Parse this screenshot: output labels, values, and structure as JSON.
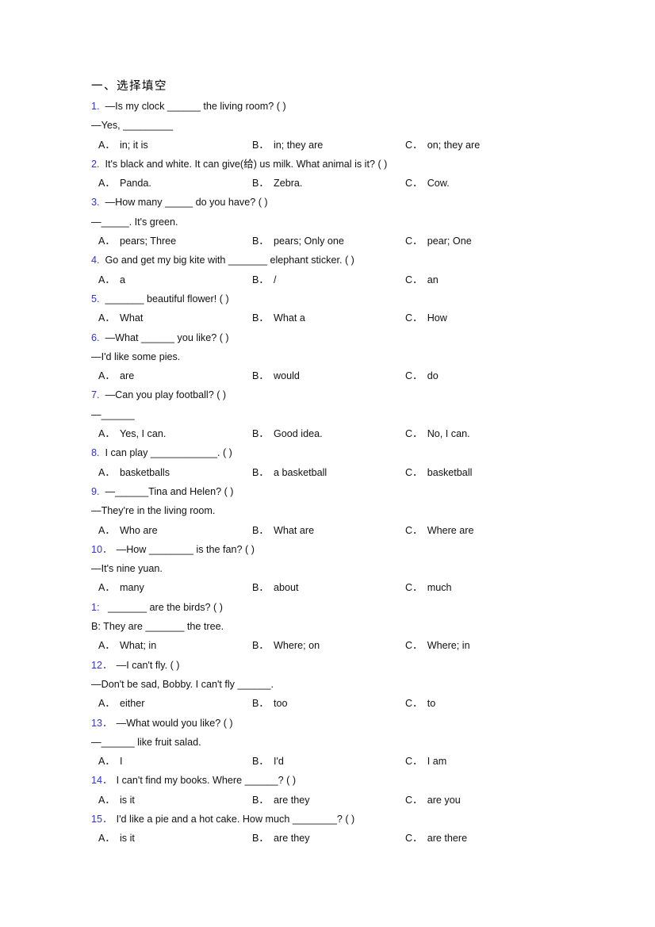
{
  "document": {
    "section_title": "一、选择填空",
    "option_labels": [
      "A．",
      "B．",
      "C．"
    ],
    "questions": [
      {
        "number": "1.",
        "stem": "—Is my clock ______ the living room? (  )",
        "continuation": "—Yes, _________",
        "options": [
          "in; it is",
          "in; they are",
          "on; they are"
        ]
      },
      {
        "number": "2.",
        "stem": "It's black and white. It can give(给) us milk. What animal is it? (  )",
        "continuation": "",
        "options": [
          "Panda.",
          "Zebra.",
          "Cow."
        ]
      },
      {
        "number": "3.",
        "stem": "—How many _____ do you have? (  )",
        "continuation": "—_____. It's green.",
        "options": [
          "pears; Three",
          "pears; Only one",
          "pear; One"
        ]
      },
      {
        "number": "4.",
        "stem": "Go and get my big kite with _______ elephant sticker. (   )",
        "continuation": "",
        "options": [
          "a",
          "/",
          "an"
        ]
      },
      {
        "number": "5.",
        "stem": "_______ beautiful flower! (   )",
        "continuation": "",
        "options": [
          "What",
          "What a",
          "How"
        ]
      },
      {
        "number": "6.",
        "stem": "—What ______ you like? (  )",
        "continuation": "—I'd like some pies.",
        "options": [
          "are",
          "would",
          "do"
        ]
      },
      {
        "number": "7.",
        "stem": "—Can you play football? (  )",
        "continuation": "—______",
        "options": [
          "Yes, I can.",
          "Good idea.",
          "No, I can."
        ]
      },
      {
        "number": "8.",
        "stem": "I can play ____________. (  )",
        "continuation": "",
        "options": [
          "basketballs",
          "a basketball",
          "basketball"
        ]
      },
      {
        "number": "9.",
        "stem": "—______Tina and Helen? (   )",
        "continuation": "—They're in the living room.",
        "options": [
          "Who are",
          "What are",
          "Where are"
        ]
      },
      {
        "number": "10．",
        "stem": "—How ________ is the fan? (    )",
        "continuation": "—It's nine yuan.",
        "options": [
          "many",
          "about",
          "much"
        ]
      },
      {
        "number": "1:",
        "stem": " _______ are the birds? (  )",
        "continuation": "B: They are _______ the tree.",
        "options": [
          "What; in",
          "Where; on",
          "Where; in"
        ]
      },
      {
        "number": "12．",
        "stem": "—I can't fly. (  )",
        "continuation": "—Don't be sad, Bobby. I can't fly ______.",
        "options": [
          "either",
          "too",
          "to"
        ]
      },
      {
        "number": "13．",
        "stem": "—What would you like? (  )",
        "continuation": "—______ like fruit salad.",
        "options": [
          "I",
          "I'd",
          "I am"
        ]
      },
      {
        "number": "14．",
        "stem": "I can't find my books. Where ______? (  )",
        "continuation": "",
        "options": [
          "is it",
          "are they",
          "are you"
        ]
      },
      {
        "number": "15．",
        "stem": "I'd like a pie and a hot cake. How much ________? (  )",
        "continuation": "",
        "options": [
          "is it",
          "are they",
          "are there"
        ]
      }
    ]
  },
  "colors": {
    "question_number": "#3333cc",
    "body_text": "#111111",
    "page_background": "#ffffff"
  }
}
